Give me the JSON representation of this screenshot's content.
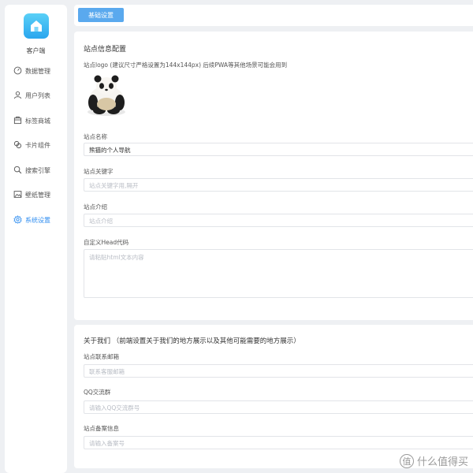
{
  "sidebar": {
    "brand": "客户端",
    "items": [
      {
        "label": "数据管理",
        "icon": "gauge-icon"
      },
      {
        "label": "用户列表",
        "icon": "user-icon"
      },
      {
        "label": "标签商城",
        "icon": "shop-icon"
      },
      {
        "label": "卡片组件",
        "icon": "cards-icon"
      },
      {
        "label": "搜索引擎",
        "icon": "search-icon"
      },
      {
        "label": "壁纸管理",
        "icon": "image-icon"
      },
      {
        "label": "系统设置",
        "icon": "gear-icon",
        "active": true
      }
    ]
  },
  "topbar": {
    "tab_label": "基础设置"
  },
  "site_info": {
    "title": "站点信息配置",
    "logo_label": "站点logo (建议尺寸严格设置为144x144px) 后续PWA等其他场景可能会用到",
    "name_label": "站点名称",
    "name_value": "熊猫的个人导航",
    "keywords_label": "站点关键字",
    "keywords_placeholder": "站点关键字用,隔开",
    "intro_label": "站点介绍",
    "intro_placeholder": "站点介绍",
    "head_label": "自定义Head代码",
    "head_placeholder": "请粘贴html文本内容"
  },
  "about": {
    "title": "关于我们 （前端设置关于我们的地方展示以及其他可能需要的地方展示）",
    "email_label": "站点联系邮箱",
    "email_placeholder": "联系客服邮箱",
    "qq_label": "QQ交流群",
    "qq_placeholder": "请输入QQ交流群号",
    "icp_label": "站点备案信息",
    "icp_placeholder": "请输入备案号"
  },
  "watermark": {
    "badge": "值",
    "text": "什么值得买"
  },
  "colors": {
    "accent": "#2d8cf0",
    "button": "#5aa9ee",
    "logo": "#2aa6ee"
  }
}
